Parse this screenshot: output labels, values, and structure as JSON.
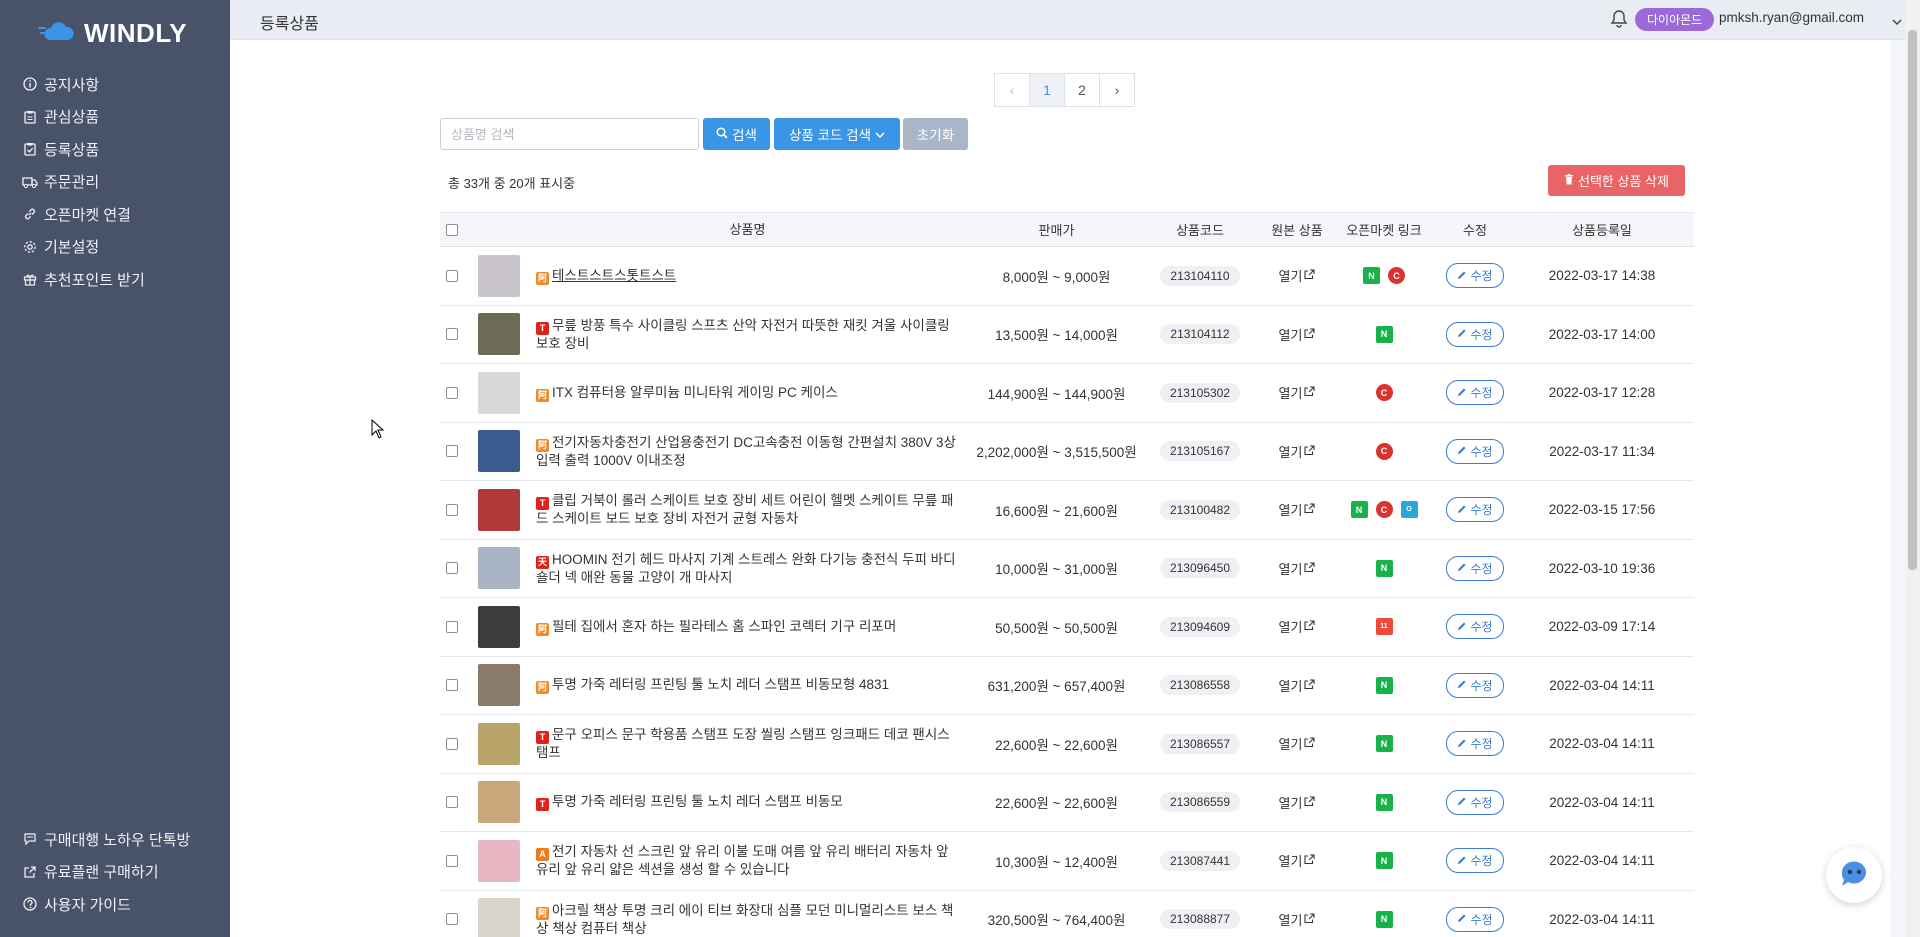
{
  "app": {
    "name": "WINDLY"
  },
  "sidebar": {
    "items": [
      {
        "label": "공지사항",
        "icon": "info-icon"
      },
      {
        "label": "관심상품",
        "icon": "clipboard-icon"
      },
      {
        "label": "등록상품",
        "icon": "clipboard-check-icon"
      },
      {
        "label": "주문관리",
        "icon": "truck-icon"
      },
      {
        "label": "오픈마켓 연결",
        "icon": "link-icon"
      },
      {
        "label": "기본설정",
        "icon": "gear-icon"
      },
      {
        "label": "추천포인트 받기",
        "icon": "gift-icon"
      }
    ],
    "bottom": [
      {
        "label": "구매대행 노하우 단톡방",
        "icon": "chat-icon"
      },
      {
        "label": "유료플랜 구매하기",
        "icon": "external-link-icon"
      },
      {
        "label": "사용자 가이드",
        "icon": "help-icon"
      }
    ]
  },
  "header": {
    "title": "등록상품",
    "plan_badge": "다이아몬드",
    "email": "pmksh.ryan@gmail.com"
  },
  "pagination": {
    "prev": "‹",
    "next": "›",
    "pages": [
      "1",
      "2"
    ],
    "current": "1"
  },
  "search": {
    "placeholder": "상품명 검색",
    "search_label": "검색",
    "code_search_label": "상품 코드 검색",
    "reset_label": "초기화"
  },
  "summary": {
    "count_text": "총 33개 중 20개 표시중",
    "delete_label": "선택한 상품 삭제"
  },
  "table": {
    "columns": {
      "name": "상품명",
      "price": "판매가",
      "code": "상품코드",
      "original": "원본 상품",
      "market": "오픈마켓 링크",
      "edit": "수정",
      "date": "상품등록일"
    },
    "open_label": "열기",
    "edit_label": "수정",
    "rows": [
      {
        "source": "1688",
        "name": "테스트스트스톳트스트",
        "price": "8,000원 ~ 9,000원",
        "code": "213104110",
        "markets": [
          "N",
          "C"
        ],
        "date": "2022-03-17 14:38",
        "thumb": "#c9c4cc"
      },
      {
        "source": "T",
        "name": "무릎 방풍 특수 사이클링 스프츠 산악 자전거 따뜻한 재킷 겨울 사이클링 보호 장비",
        "price": "13,500원 ~ 14,000원",
        "code": "213104112",
        "markets": [
          "N"
        ],
        "date": "2022-03-17 14:00",
        "thumb": "#6d6a55"
      },
      {
        "source": "1688",
        "name": "ITX 컴퓨터용 알루미늄 미니타워 게이밍 PC 케이스",
        "price": "144,900원 ~ 144,900원",
        "code": "213105302",
        "markets": [
          "C"
        ],
        "date": "2022-03-17 12:28",
        "thumb": "#d8d8d8"
      },
      {
        "source": "1688",
        "name": "전기자동차충전기 산업용충전기 DC고속충전 이동형 간편설치 380V 3상 입력 출력 1000V 이내조정",
        "price": "2,202,000원 ~ 3,515,500원",
        "code": "213105167",
        "markets": [
          "C"
        ],
        "date": "2022-03-17 11:34",
        "thumb": "#3b5b8e"
      },
      {
        "source": "T",
        "name": "클립 거북이 롤러 스케이트 보호 장비 세트 어린이 헬멧 스케이트 무릎 패드 스케이트 보드 보호 장비 자전거 균형 자동차",
        "price": "16,600원 ~ 21,600원",
        "code": "213100482",
        "markets": [
          "N",
          "C",
          "O"
        ],
        "date": "2022-03-15 17:56",
        "thumb": "#b33a3a"
      },
      {
        "source": "TM",
        "name": "HOOMIN 전기 헤드 마사지 기계 스트레스 완화 다기능 충전식 두피 바디 숄더 넥 애완 동물 고양이 개 마사지",
        "price": "10,000원 ~ 31,000원",
        "code": "213096450",
        "markets": [
          "N"
        ],
        "date": "2022-03-10 19:36",
        "thumb": "#a9b4c4"
      },
      {
        "source": "1688",
        "name": "필테 집에서 혼자 하는 필라테스 홈 스파인 코렉터 기구 리포머",
        "price": "50,500원 ~ 50,500원",
        "code": "213094609",
        "markets": [
          "11"
        ],
        "date": "2022-03-09 17:14",
        "thumb": "#3c3c3c"
      },
      {
        "source": "1688",
        "name": "투명 가죽 레터링 프린팅 툴 노치 레더 스탬프 비동모형 4831",
        "price": "631,200원 ~ 657,400원",
        "code": "213086558",
        "markets": [
          "N"
        ],
        "date": "2022-03-04 14:11",
        "thumb": "#8a7a6a"
      },
      {
        "source": "T",
        "name": "문구 오피스 문구 학용품 스탬프 도장 씰링 스탬프 잉크패드 데코 팬시스탬프",
        "price": "22,600원 ~ 22,600원",
        "code": "213086557",
        "markets": [
          "N"
        ],
        "date": "2022-03-04 14:11",
        "thumb": "#b9a46a"
      },
      {
        "source": "T",
        "name": "투명 가죽 레터링 프린팅 툴 노치 레더 스탬프 비동모",
        "price": "22,600원 ~ 22,600원",
        "code": "213086559",
        "markets": [
          "N"
        ],
        "date": "2022-03-04 14:11",
        "thumb": "#c9a77a"
      },
      {
        "source": "AL",
        "name": "전기 자동차 선 스크린 앞 유리 이불 도매 여름 앞 유리 배터리 자동차 앞 유리 앞 유리 얇은 섹션을 생성 할 수 있습니다",
        "price": "10,300원 ~ 12,400원",
        "code": "213087441",
        "markets": [
          "N"
        ],
        "date": "2022-03-04 14:11",
        "thumb": "#e7b7c4"
      },
      {
        "source": "1688",
        "name": "아크릴 책상 투명 크리 에이 티브 화장대 심플 모던 미니멀리스트 보스 책상 책상 컴퓨터 책상",
        "price": "320,500원 ~ 764,400원",
        "code": "213088877",
        "markets": [
          "N"
        ],
        "date": "2022-03-04 14:11",
        "thumb": "#d9d4cc"
      }
    ]
  },
  "colors": {
    "sidebar": "#48536a",
    "primary": "#3a95e6",
    "danger": "#e96565",
    "badge": "#9b6ad8"
  }
}
